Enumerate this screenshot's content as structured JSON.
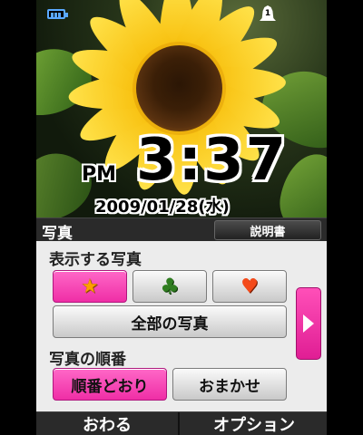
{
  "wallpaper": {
    "ampm": "PM",
    "time": "3:37",
    "date": "2009/01/28(水)",
    "manner_icon_text": "1"
  },
  "header": {
    "title": "写真",
    "manual_label": "説明書"
  },
  "display_section": {
    "label": "表示する写真",
    "filters": [
      {
        "icon": "star-icon",
        "glyph": "★",
        "color": "#ff9e00",
        "selected": true
      },
      {
        "icon": "club-icon",
        "glyph": "♣",
        "color": "#2f7d20",
        "selected": false
      },
      {
        "icon": "heart-icon",
        "glyph": "♥",
        "color": "#f44a1a",
        "selected": false
      }
    ],
    "all_photos_label": "全部の写真"
  },
  "order_section": {
    "label": "写真の順番",
    "options": [
      {
        "label": "順番どおり",
        "selected": true
      },
      {
        "label": "おまかせ",
        "selected": false
      }
    ]
  },
  "softkeys": {
    "left": "おわる",
    "right": "オプション"
  },
  "colors": {
    "accent_pink": "#ef2ea6",
    "battery_blue": "#5aa9ff"
  }
}
